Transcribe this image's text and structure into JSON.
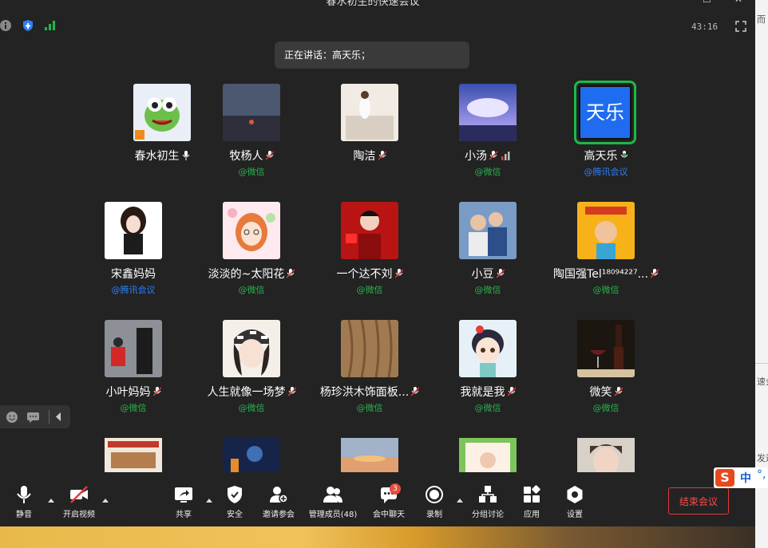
{
  "window": {
    "title": "春水初生的快速会议"
  },
  "header": {
    "timer": "43:16",
    "speaking_label": "正在讲话：高天乐；"
  },
  "side_window": {
    "text_top": "而",
    "text_mid": "速会",
    "text_low": "发送"
  },
  "participants": [
    {
      "name": "春水初生",
      "source": ""
    },
    {
      "name": "牧杨人",
      "source": "@微信"
    },
    {
      "name": "陶洁",
      "source": "@微信"
    },
    {
      "name": "小汤",
      "source": "@微信"
    },
    {
      "name": "高天乐",
      "source": "@腾讯会议",
      "avatar_text": "天乐"
    },
    {
      "name": "宋鑫妈妈",
      "source": "@腾讯会议"
    },
    {
      "name": "淡淡的~太阳花",
      "source": "@微信"
    },
    {
      "name": "一个达不刘",
      "source": "@微信"
    },
    {
      "name": "小豆",
      "source": "@微信"
    },
    {
      "name": "陶国强Tel¹⁸⁰⁹⁴²²⁷...",
      "source": "@微信"
    },
    {
      "name": "小叶妈妈",
      "source": "@微信"
    },
    {
      "name": "人生就像一场梦",
      "source": "@微信"
    },
    {
      "name": "杨珍洪木饰面板...",
      "source": "@微信"
    },
    {
      "name": "我就是我",
      "source": "@微信"
    },
    {
      "name": "微笑",
      "source": "@微信"
    }
  ],
  "toolbar": {
    "mute": "静音",
    "video": "开启视频",
    "share": "共享",
    "security": "安全",
    "invite": "邀请参会",
    "manage": "管理成员(48)",
    "chat": "会中聊天",
    "chat_badge": "3",
    "record": "录制",
    "breakout": "分组讨论",
    "apps": "应用",
    "settings": "设置",
    "end": "结束会议"
  },
  "ime": {
    "label": "中"
  },
  "colors": {
    "active_border": "#1fb84a",
    "wechat": "#25b34b",
    "tencent": "#2d7ff9",
    "end_red": "#e23a3a"
  }
}
